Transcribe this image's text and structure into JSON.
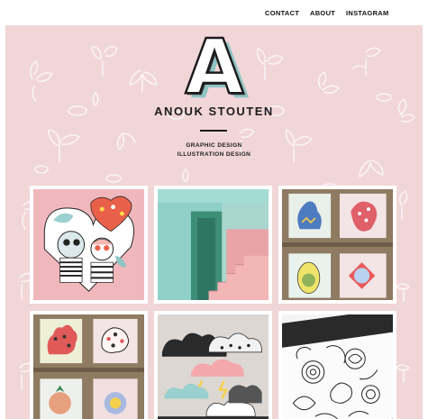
{
  "nav": {
    "contact": "CONTACT",
    "about": "ABOUT",
    "instagram": "INSTAGRAM"
  },
  "brand": {
    "logo_letter": "A",
    "name": "ANOUK STOUTEN",
    "tagline_1": "GRAPHIC DESIGN",
    "tagline_2": "ILLUSTRATION DESIGN"
  },
  "colors": {
    "hero_background": "#f1d6d8",
    "pattern_line": "#ffffff",
    "logo_shadow": "#8fc3c4",
    "text": "#1c1c1c"
  },
  "gallery": {
    "tiles": [
      {
        "subject": "collage-heart-figures"
      },
      {
        "subject": "pink-teal-stairs"
      },
      {
        "subject": "framed-floral-prints"
      },
      {
        "subject": "framed-coral-prints"
      },
      {
        "subject": "cloud-paper-cutouts"
      },
      {
        "subject": "floral-line-drawings"
      }
    ]
  },
  "icons": {
    "pattern": "leaf-pattern-icon"
  }
}
